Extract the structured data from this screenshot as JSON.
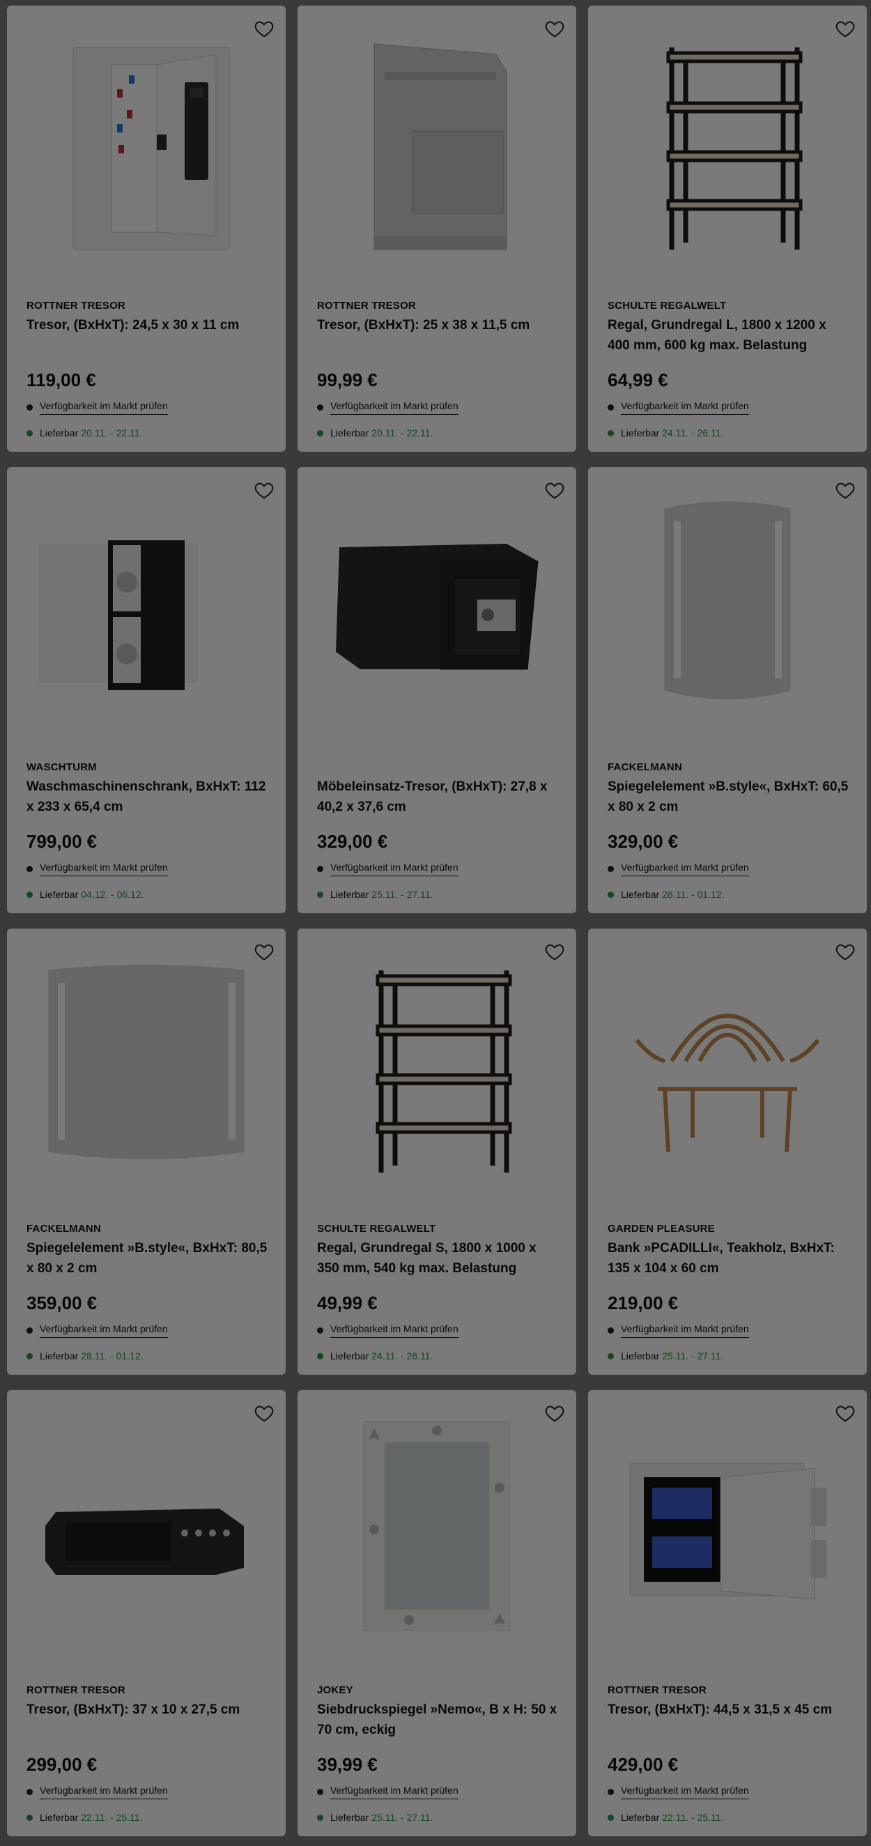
{
  "labels": {
    "availability": "Verfügbarkeit im Markt prüfen",
    "delivery_prefix": "Lieferbar"
  },
  "colors": {
    "delivery_green": "#2f8f4c",
    "overlay": "rgba(0,0,0,0.52)"
  },
  "products": [
    {
      "brand": "ROTTNER TRESOR",
      "title": "Tresor, (BxHxT): 24,5 x 30 x 11 cm",
      "price": "119,00 €",
      "delivery": "20.11. - 22.11.",
      "image": "key-safe-image"
    },
    {
      "brand": "ROTTNER TRESOR",
      "title": "Tresor, (BxHxT): 25 x 38 x 11,5 cm",
      "price": "99,99 €",
      "delivery": "20.11. - 22.11.",
      "image": "deposit-safe-image"
    },
    {
      "brand": "SCHULTE REGALWELT",
      "title": "Regal, Grundregal L, 1800 x 1200 x 400 mm, 600 kg max. Belastung",
      "price": "64,99 €",
      "delivery": "24.11. - 26.11.",
      "image": "shelf-image"
    },
    {
      "brand": "WASCHTURM",
      "title": "Waschmaschinenschrank, BxHxT: 112 x 233 x 65,4 cm",
      "price": "799,00 €",
      "delivery": "04.12. - 06.12.",
      "image": "washer-cabinet-image"
    },
    {
      "brand": "",
      "title": "Möbeleinsatz-Tresor, (BxHxT): 27,8 x 40,2 x 37,6 cm",
      "price": "329,00 €",
      "delivery": "25.11. - 27.11.",
      "image": "furniture-safe-image"
    },
    {
      "brand": "FACKELMANN",
      "title": "Spiegelelement »B.style«, BxHxT: 60,5 x 80 x 2 cm",
      "price": "329,00 €",
      "delivery": "28.11. - 01.12.",
      "image": "mirror-tall-image"
    },
    {
      "brand": "FACKELMANN",
      "title": "Spiegelelement »B.style«, BxHxT: 80,5 x 80 x 2 cm",
      "price": "359,00 €",
      "delivery": "28.11. - 01.12.",
      "image": "mirror-wide-image"
    },
    {
      "brand": "SCHULTE REGALWELT",
      "title": "Regal, Grundregal S, 1800 x 1000 x 350 mm, 540 kg max. Belastung",
      "price": "49,99 €",
      "delivery": "24.11. - 26.11.",
      "image": "shelf-image"
    },
    {
      "brand": "GARDEN PLEASURE",
      "title": "Bank »PCADILLI«, Teakholz, BxHxT: 135 x 104 x 60 cm",
      "price": "219,00 €",
      "delivery": "25.11. - 27.11.",
      "image": "teak-bench-image"
    },
    {
      "brand": "ROTTNER TRESOR",
      "title": "Tresor, (BxHxT): 37 x 10 x 27,5 cm",
      "price": "299,00 €",
      "delivery": "22.11. - 25.11.",
      "image": "flat-safe-image"
    },
    {
      "brand": "JOKEY",
      "title": "Siebdruckspiegel »Nemo«, B x H: 50 x 70 cm, eckig",
      "price": "39,99 €",
      "delivery": "25.11. - 27.11.",
      "image": "seashell-mirror-image"
    },
    {
      "brand": "ROTTNER TRESOR",
      "title": "Tresor, (BxHxT): 44,5 x 31,5 x 45 cm",
      "price": "429,00 €",
      "delivery": "22.11. - 25.11.",
      "image": "open-safe-image"
    }
  ]
}
